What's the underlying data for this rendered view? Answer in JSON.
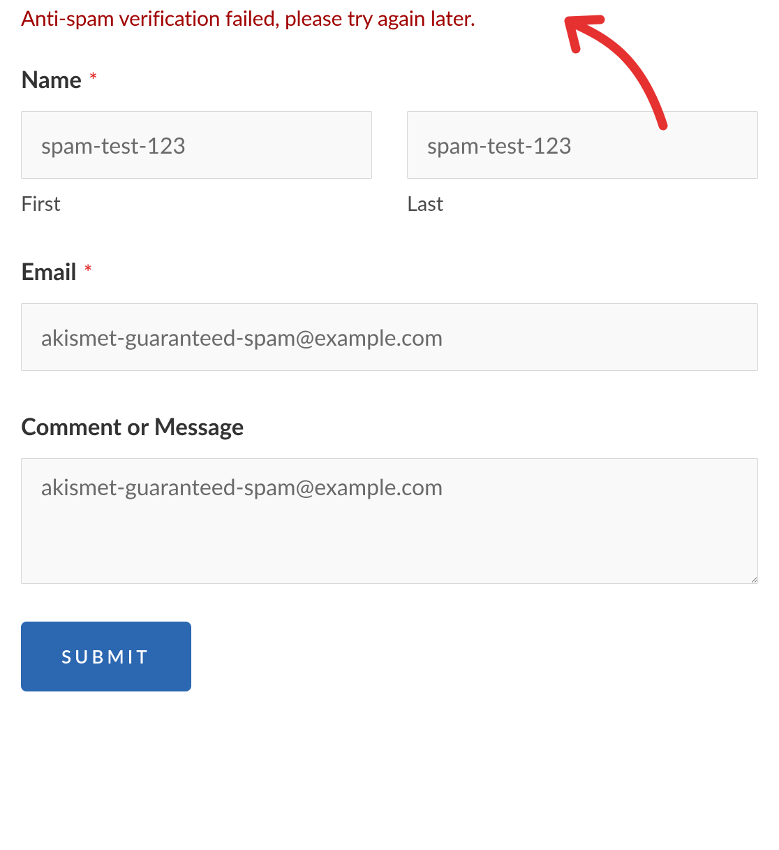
{
  "error": {
    "message": "Anti-spam verification failed, please try again later."
  },
  "fields": {
    "name": {
      "label": "Name",
      "required_mark": "*",
      "first": {
        "value": "spam-test-123",
        "sublabel": "First"
      },
      "last": {
        "value": "spam-test-123",
        "sublabel": "Last"
      }
    },
    "email": {
      "label": "Email",
      "required_mark": "*",
      "value": "akismet-guaranteed-spam@example.com"
    },
    "comment": {
      "label": "Comment or Message",
      "value": "akismet-guaranteed-spam@example.com"
    }
  },
  "submit": {
    "label": "SUBMIT"
  },
  "colors": {
    "error": "#a00000",
    "button_bg": "#2c67b1",
    "annotation": "#e63131"
  }
}
